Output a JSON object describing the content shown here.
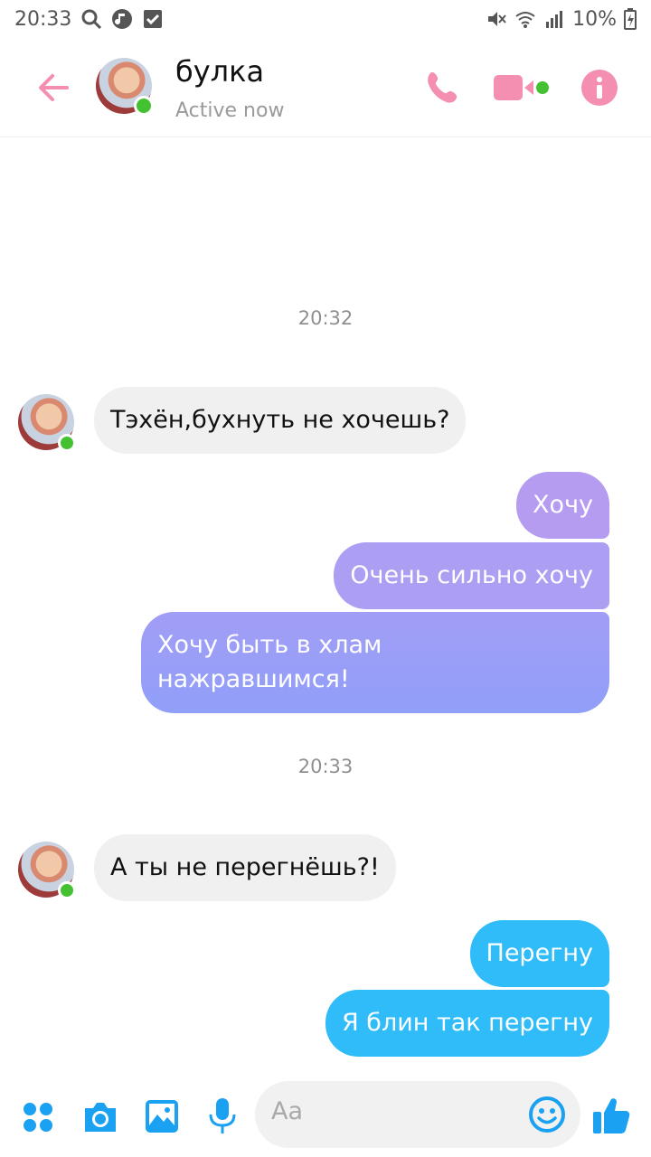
{
  "status_bar": {
    "time": "20:33",
    "battery": "10%",
    "icons": [
      "search-icon",
      "music-icon",
      "checkbox-icon",
      "mute-icon",
      "wifi-icon",
      "signal-icon",
      "battery-icon"
    ]
  },
  "header": {
    "contact_name": "булка",
    "contact_status": "Active now",
    "icons": [
      "back-arrow-icon",
      "phone-icon",
      "video-icon",
      "info-icon"
    ],
    "accent_color": "#f48fb1"
  },
  "messages": {
    "timestamp_1": "20:32",
    "incoming_1": "Тэхён,бухнуть не хочешь?",
    "outgoing_1": "Хочу",
    "outgoing_2": "Очень сильно хочу",
    "outgoing_3": "Хочу быть в хлам\nнажравшимся!",
    "timestamp_2": "20:33",
    "incoming_2": "А ты не перегнёшь?!",
    "outgoing_4": "Перегну",
    "outgoing_5": "Я блин так перегну"
  },
  "composer": {
    "placeholder": "Aa",
    "icons": [
      "menu-dots-icon",
      "camera-icon",
      "gallery-icon",
      "mic-icon",
      "emoji-icon",
      "thumbs-up-icon"
    ],
    "accent_color": "#1ba1f2"
  },
  "colors": {
    "bubble_purple": "#b59cf0",
    "bubble_violet": "#9b9af7",
    "bubble_blue": "#2fbcf8",
    "online": "#44c131"
  }
}
